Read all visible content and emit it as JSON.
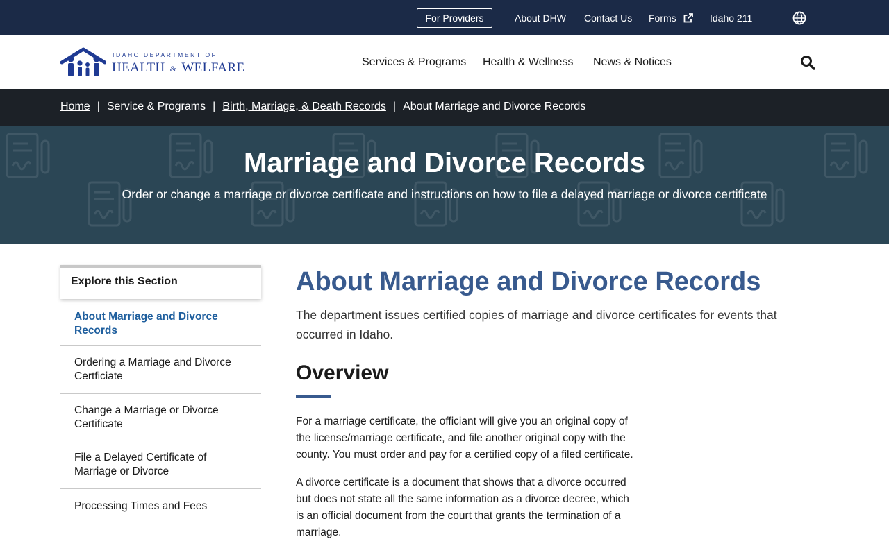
{
  "utility_bar": {
    "providers_label": "For Providers",
    "links": [
      "About DHW",
      "Contact Us",
      "Forms",
      "Idaho 211"
    ]
  },
  "logo": {
    "small_text": "IDAHO DEPARTMENT OF",
    "big_text_1": "HEALTH",
    "big_text_amp": "&",
    "big_text_2": "WELFARE"
  },
  "main_nav": [
    "Services & Programs",
    "Health & Wellness",
    "News & Notices"
  ],
  "breadcrumb": [
    "Home",
    "Service & Programs",
    "Birth, Marriage, & Death Records",
    "About Marriage and Divorce Records"
  ],
  "hero": {
    "title": "Marriage and Divorce Records",
    "subtitle": "Order or change a marriage or divorce certificate and instructions on how to file a delayed marriage or divorce certificate"
  },
  "sidebar": {
    "title": "Explore this Section",
    "items": [
      {
        "label": "About Marriage and Divorce Records"
      },
      {
        "label": "Ordering a Marriage and Divorce Certficiate"
      },
      {
        "label": "Change a Marriage or Divorce Certificate"
      },
      {
        "label": "File a Delayed Certificate of Marriage or Divorce"
      },
      {
        "label": "Processing Times and Fees"
      }
    ]
  },
  "main": {
    "title": "About Marriage and Divorce Records",
    "lead": "The department issues certified copies of marriage and divorce certificates for events that occurred in Idaho.",
    "overview_heading": "Overview",
    "paragraphs": [
      "For a marriage certificate, the officiant will give you an original copy of the license/marriage certificate, and file another original copy with the county. You must order and pay for a certified copy of a filed certificate.",
      "A divorce certificate is a document that shows that a divorce occurred but does not state all the same information as a divorce decree, which is an official document from the court that grants the termination of a marriage."
    ]
  },
  "colors": {
    "utility_bar": "#1b2a47",
    "breadcrumb_bar": "#1c2127",
    "hero": "#2b4655",
    "title_blue": "#385a8e",
    "sidebar_active": "#1f5f9e"
  },
  "icons": [
    "external-link-icon",
    "globe-icon",
    "search-icon",
    "document-pattern-icon"
  ]
}
